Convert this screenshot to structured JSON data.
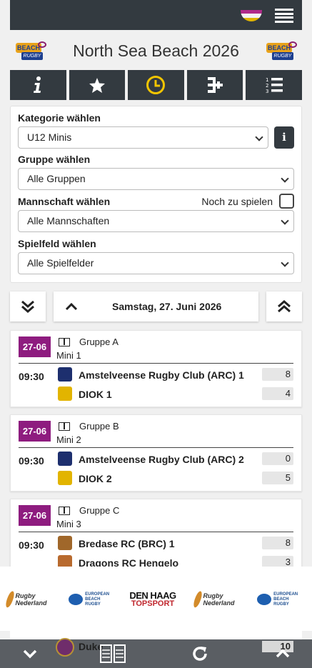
{
  "app": {
    "title": "North Sea Beach 2026"
  },
  "header": {
    "flag_colors": [
      "#b02a8a",
      "#f3f3f3",
      "#e0b400"
    ]
  },
  "nav": {
    "tabs": [
      "info-icon",
      "star-icon",
      "clock-icon",
      "bracket-icon",
      "ranking-list-icon"
    ],
    "active_color": "#f2c500"
  },
  "filters": {
    "category_label": "Kategorie wählen",
    "category_value": "U12 Minis",
    "info_label": "i",
    "group_label": "Gruppe wählen",
    "group_value": "Alle Gruppen",
    "team_label": "Mannschaft wählen",
    "todo_label": "Noch zu spielen",
    "team_value": "Alle Mannschaften",
    "field_label": "Spielfeld wählen",
    "field_value": "Alle Spielfelder"
  },
  "day": {
    "label": "Samstag, 27. Juni 2026"
  },
  "matches": [
    {
      "date": "27-06",
      "group": "Gruppe A",
      "field": "Mini 1",
      "time": "09:30",
      "home": "Amstelveense Rugby Club (ARC) 1",
      "home_score": "8",
      "away": "DIOK 1",
      "away_score": "4"
    },
    {
      "date": "27-06",
      "group": "Gruppe B",
      "field": "Mini 2",
      "time": "09:30",
      "home": "Amstelveense Rugby Club (ARC) 2",
      "home_score": "0",
      "away": "DIOK 2",
      "away_score": "5"
    },
    {
      "date": "27-06",
      "group": "Gruppe C",
      "field": "Mini 3",
      "time": "09:30",
      "home": "Bredase RC (BRC) 1",
      "home_score": "8",
      "away": "Dragons RC Hengelo",
      "away_score": "3"
    }
  ],
  "sponsors": {
    "rugby_nl": "Rugby Nederland",
    "ebr_1": "EUROPEAN",
    "ebr_2": "BEACH RUGBY",
    "dh_1": "DEN HAAG",
    "dh_2": "TOPSPORT"
  },
  "peek": {
    "team": "Duke",
    "score": "10"
  },
  "colors": {
    "dark": "#333a40",
    "badge": "#8e1c7f"
  }
}
